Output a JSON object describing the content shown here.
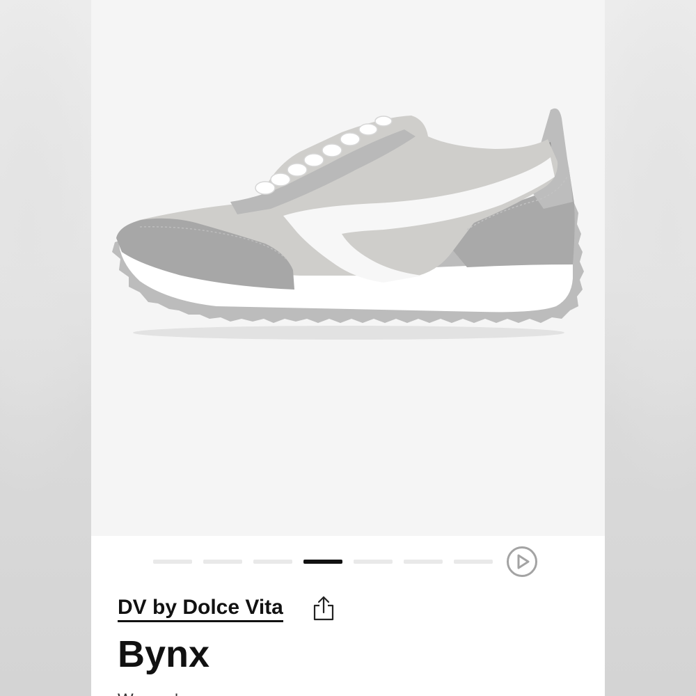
{
  "product": {
    "brand": "DV by Dolce Vita",
    "name": "Bynx",
    "subtitle": "Women's"
  },
  "carousel": {
    "slide_count": 7,
    "active_index": 3
  },
  "icons": {
    "share": "share-icon",
    "play": "play-icon"
  },
  "colors": {
    "image_background": "#f5f5f5",
    "active_indicator": "#111111",
    "inactive_indicator": "#e9e9e9",
    "play_ring": "#a3a3a3"
  }
}
